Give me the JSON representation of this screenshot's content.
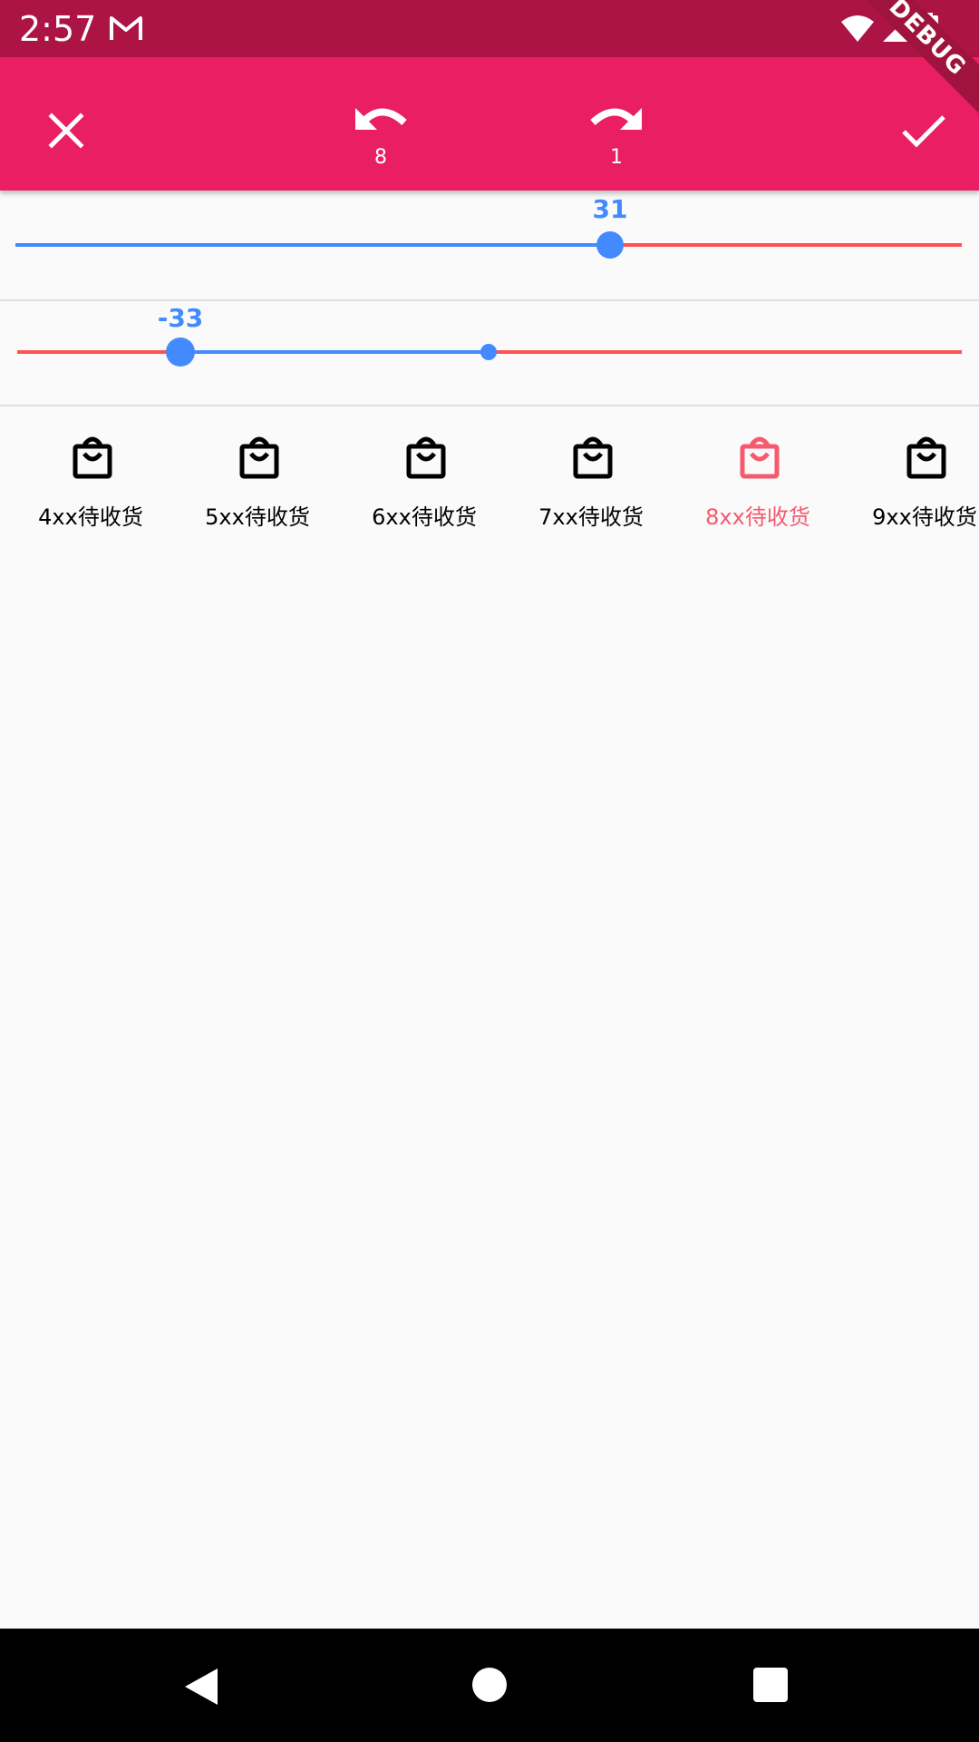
{
  "status": {
    "time": "2:57"
  },
  "app_bar": {
    "undo_count": "8",
    "redo_count": "1",
    "debug_badge": "DEBUG"
  },
  "sliders": [
    {
      "value_label": "31",
      "value_fraction": 0.66
    },
    {
      "value_label": "-33",
      "value_fraction": 0.17
    }
  ],
  "tabs": [
    {
      "label": "4xx待收货",
      "icon": "shopping-bag-icon",
      "selected": false
    },
    {
      "label": "5xx待收货",
      "icon": "shopping-bag-icon",
      "selected": false
    },
    {
      "label": "6xx待收货",
      "icon": "shopping-bag-icon",
      "selected": false
    },
    {
      "label": "7xx待收货",
      "icon": "shopping-bag-icon",
      "selected": false
    },
    {
      "label": "8xx待收货",
      "icon": "shopping-bag-icon",
      "selected": true
    },
    {
      "label": "9xx待收货",
      "icon": "shopping-bag-icon",
      "selected": false
    }
  ],
  "colors": {
    "status_bar": "#ad1446",
    "app_bar": "#e91e63",
    "slider_active": "#448aff",
    "slider_inactive": "#ff5252",
    "tab_selected": "#f55a6e",
    "tab_default": "#000000"
  }
}
